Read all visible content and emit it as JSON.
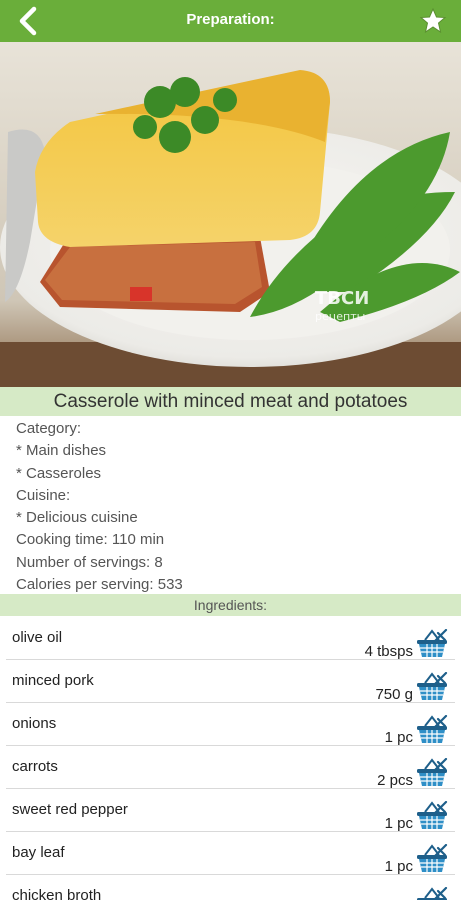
{
  "header": {
    "title": "Preparation:",
    "back_icon": "back-arrow-icon",
    "favorite_icon": "star-icon",
    "bar_color": "#6aae3a"
  },
  "recipe": {
    "title": "Casserole with minced meat and potatoes",
    "image_watermark_line1": "ТВСИ",
    "image_watermark_line2": "рецепты",
    "info_lines": [
      "Category:",
      "* Main dishes",
      "* Casseroles",
      "Cuisine:",
      "* Delicious cuisine",
      "Cooking time: 110 min",
      "Number of servings: 8",
      "Calories per serving: 533"
    ]
  },
  "ingredients": {
    "header": "Ingredients:",
    "items": [
      {
        "name": "olive oil",
        "qty": "4 tbsps"
      },
      {
        "name": "minced pork",
        "qty": "750 g"
      },
      {
        "name": "onions",
        "qty": "1 pc"
      },
      {
        "name": "carrots",
        "qty": "2 pcs"
      },
      {
        "name": "sweet red pepper",
        "qty": "1 pc"
      },
      {
        "name": "bay leaf",
        "qty": "1 pc"
      },
      {
        "name": "chicken broth",
        "qty": ""
      }
    ],
    "add_icon": "shopping-basket-icon"
  }
}
